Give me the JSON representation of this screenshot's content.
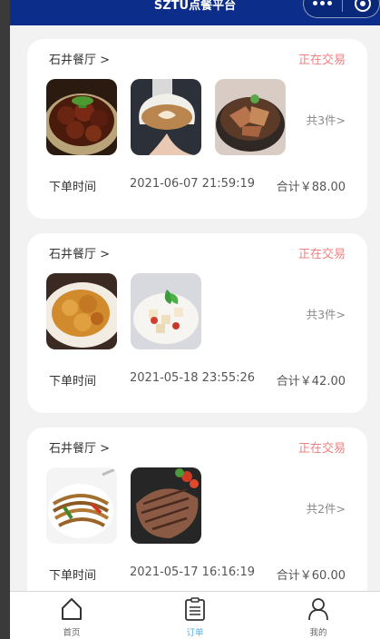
{
  "header": {
    "title": "SZTU点餐平台",
    "menu_icon": "more-dots-icon",
    "close_icon": "capsule-close-icon"
  },
  "orders": [
    {
      "shop": "石井餐厅 >",
      "status": "正在交易",
      "dishes": [
        "braised-beef-stew-image",
        "latte-coffee-image",
        "braised-pork-claypot-image"
      ],
      "count": "共3件>",
      "time_label": "下单时间",
      "time": "2021-06-07 21:59:19",
      "total": "合计￥88.00"
    },
    {
      "shop": "石井餐厅 >",
      "status": "正在交易",
      "dishes": [
        "fried-dish-plate-image",
        "salad-bowl-image"
      ],
      "count": "共3件>",
      "time_label": "下单时间",
      "time": "2021-05-18 23:55:26",
      "total": "合计￥42.00"
    },
    {
      "shop": "石井餐厅 >",
      "status": "正在交易",
      "dishes": [
        "fried-noodles-image",
        "grilled-steak-image"
      ],
      "count": "共2件>",
      "time_label": "下单时间",
      "time": "2021-05-17 16:16:19",
      "total": "合计￥60.00"
    }
  ],
  "tabbar": {
    "items": [
      {
        "label": "首页",
        "icon": "home-icon",
        "active": false
      },
      {
        "label": "订单",
        "icon": "order-list-icon",
        "active": true
      },
      {
        "label": "我的",
        "icon": "user-profile-icon",
        "active": false
      }
    ]
  },
  "colors": {
    "nav_bar": "#0c2e8a",
    "status": "#f08080",
    "tab_active": "#5cb3e6",
    "page_bg": "#f2f2f2"
  }
}
